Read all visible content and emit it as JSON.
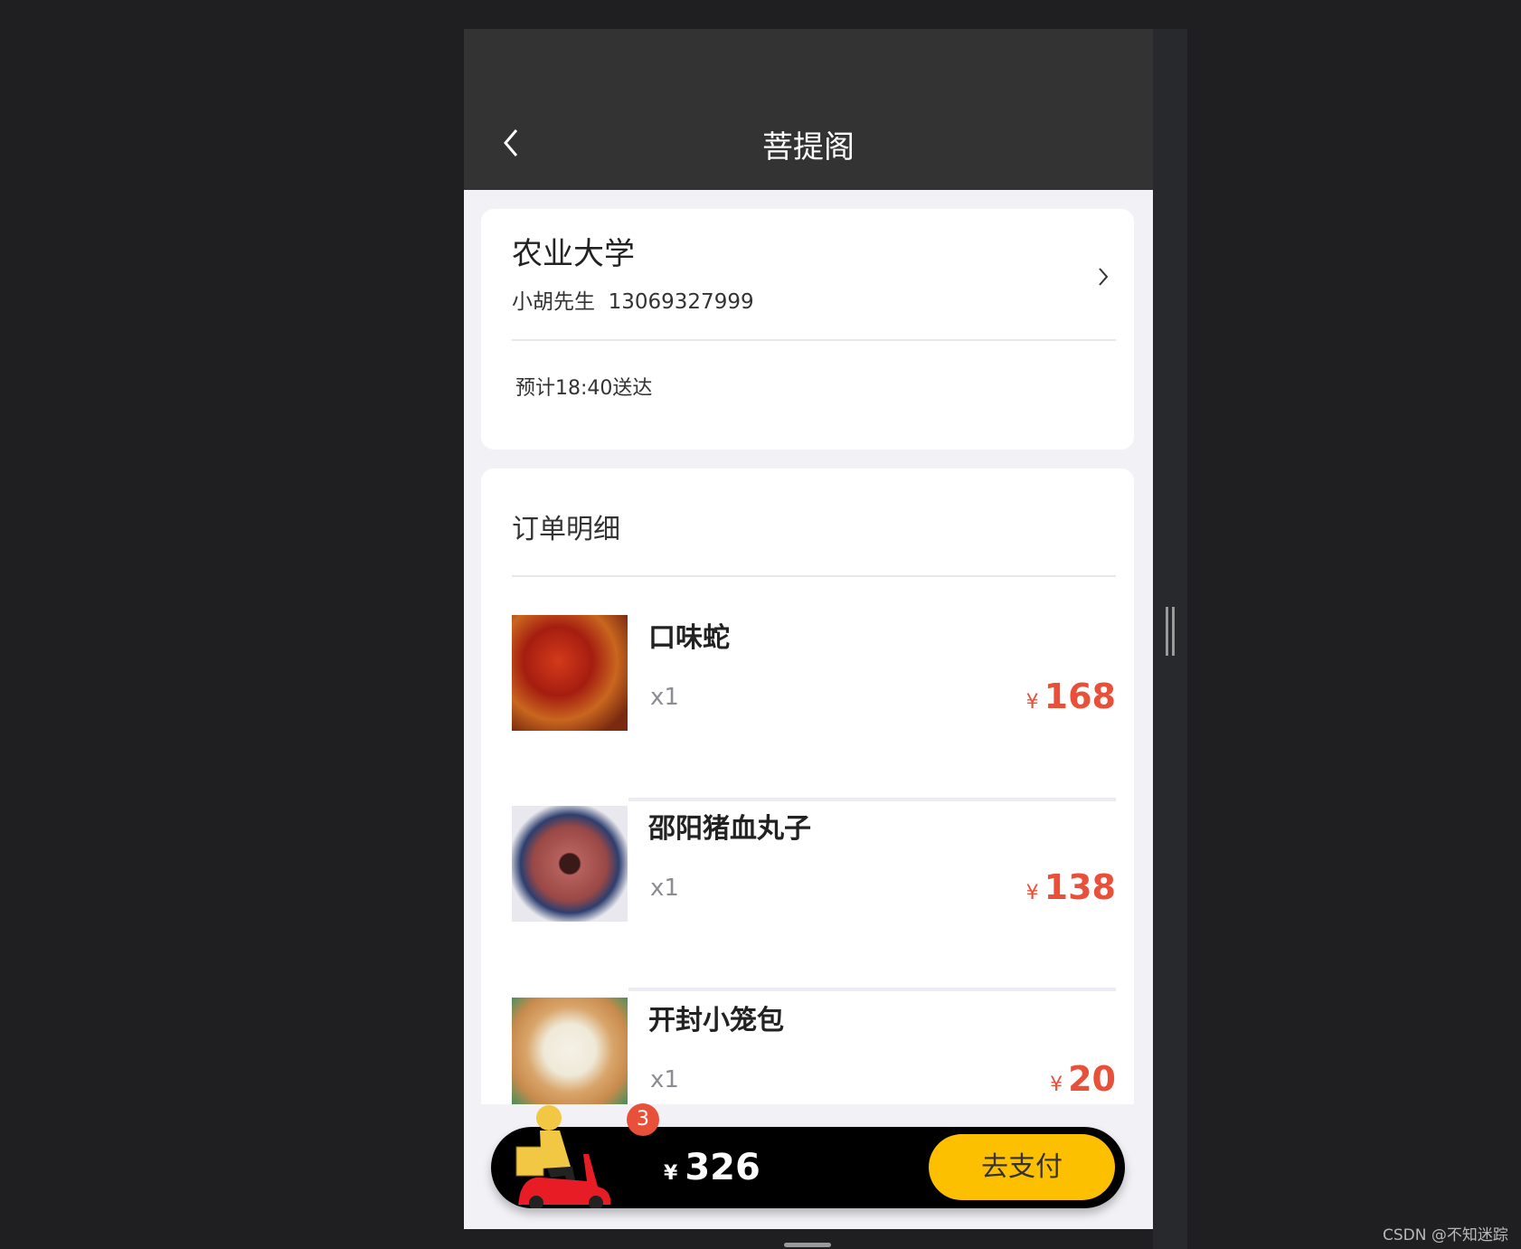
{
  "header": {
    "title": "菩提阁",
    "back_icon": "chevron-left-icon"
  },
  "address": {
    "name": "农业大学",
    "contact": "小胡先生  13069327999",
    "eta": "预计18:40送达",
    "chevron_icon": "chevron-right-icon"
  },
  "order": {
    "title": "订单明细",
    "items": [
      {
        "name": "口味蛇",
        "qty": "x1",
        "currency": "¥",
        "price": "168",
        "image": "spicy-snake-dish"
      },
      {
        "name": "邵阳猪血丸子",
        "qty": "x1",
        "currency": "¥",
        "price": "138",
        "image": "blood-sausage-plate"
      },
      {
        "name": "开封小笼包",
        "qty": "x1",
        "currency": "¥",
        "price": "20",
        "image": "steamed-buns-basket"
      }
    ]
  },
  "cart": {
    "count": "3",
    "currency": "¥",
    "total": "326",
    "pay_label": "去支付",
    "icon": "delivery-rider-icon"
  },
  "colors": {
    "header": "#333333",
    "price": "#e8503a",
    "pay_button": "#fdc000",
    "badge": "#e8503a"
  },
  "watermark": "CSDN @不知迷踪"
}
